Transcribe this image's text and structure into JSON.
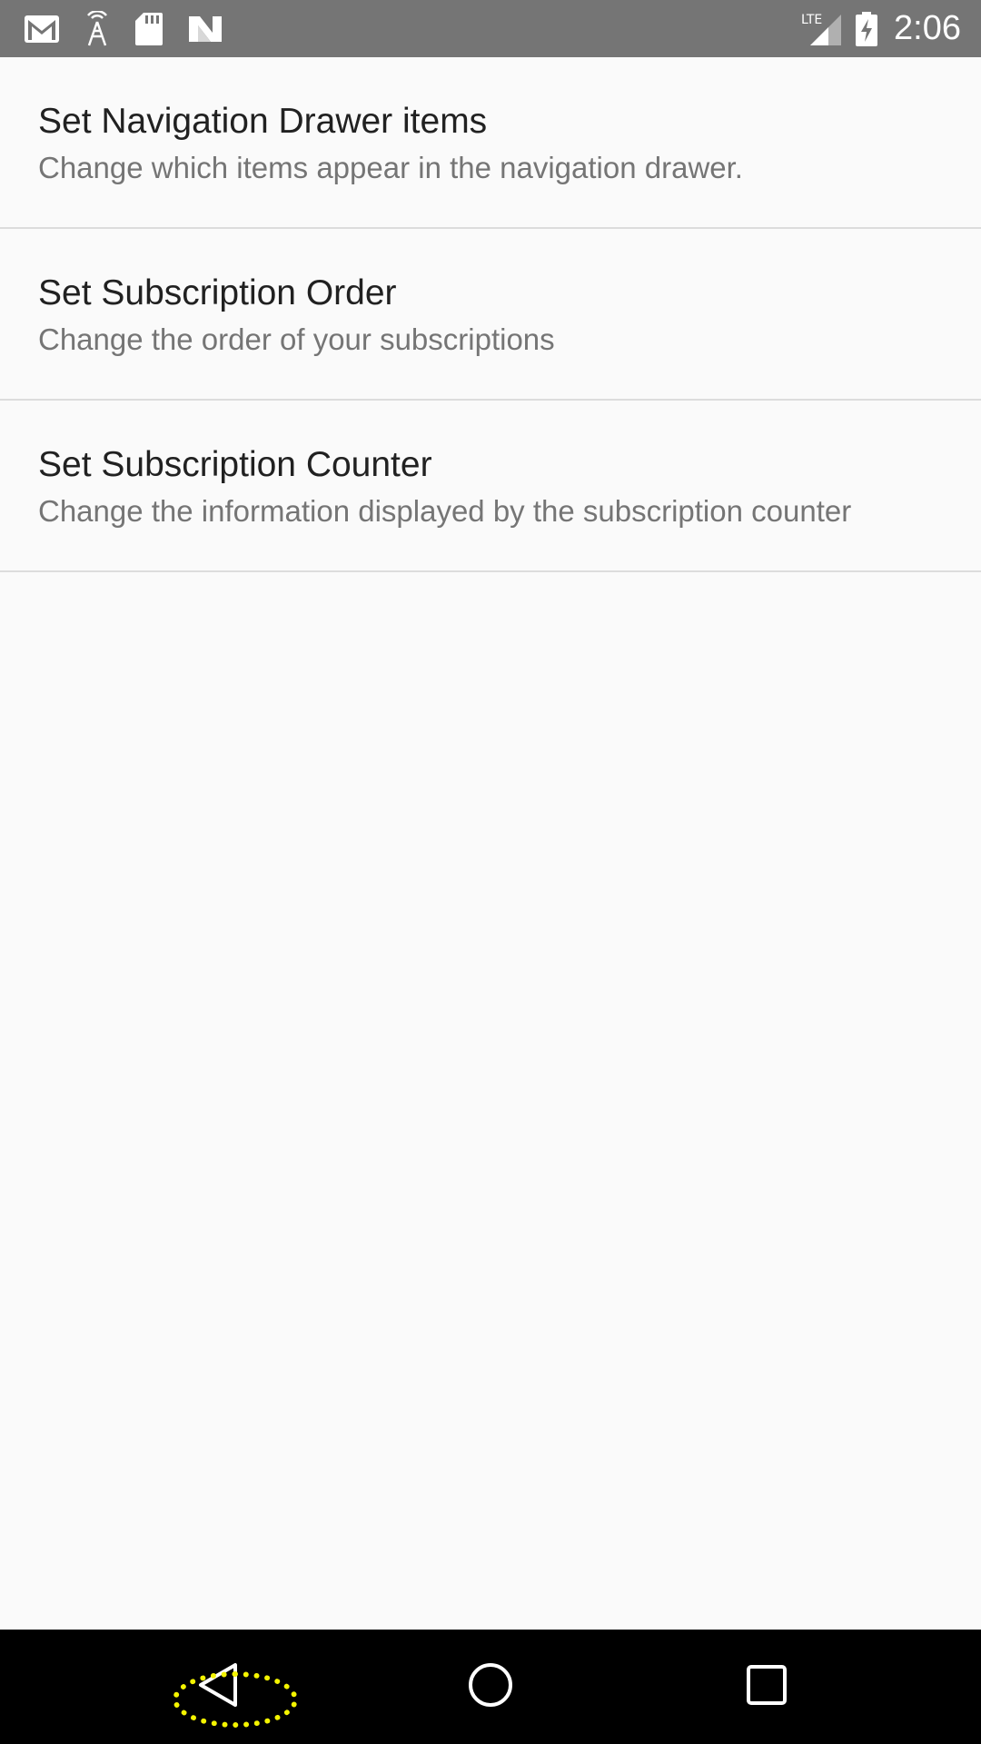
{
  "status_bar": {
    "left_icons": [
      "gmail-icon",
      "antenna-icon",
      "sd-card-icon",
      "n-logo-icon"
    ],
    "network_label": "LTE",
    "time": "2:06"
  },
  "preferences": [
    {
      "title": "Set Navigation Drawer items",
      "summary": "Change which items appear in the navigation drawer."
    },
    {
      "title": "Set Subscription Order",
      "summary": "Change the order of your subscriptions"
    },
    {
      "title": "Set Subscription Counter",
      "summary": "Change the information displayed by the subscription counter"
    }
  ],
  "nav_bar": {
    "buttons": [
      "back-icon",
      "home-icon",
      "recents-icon"
    ]
  },
  "colors": {
    "status_bar": "#757575",
    "background": "#fafafa",
    "title_text": "#212121",
    "summary_text": "#757575",
    "divider": "#dcdcdc",
    "nav_bar": "#000000",
    "highlight": "#f4f400"
  }
}
